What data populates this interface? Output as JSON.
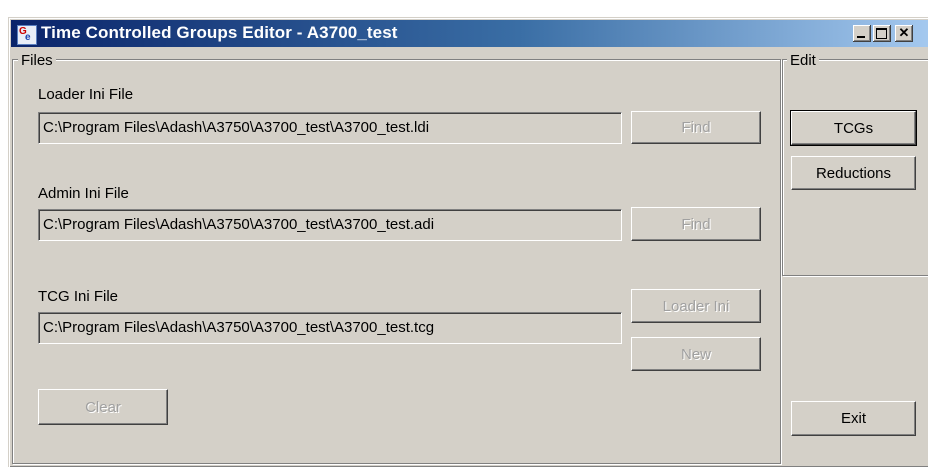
{
  "window": {
    "title": "Time Controlled Groups Editor - A3700_test",
    "icon": "tcg-app-icon",
    "icon_glyphs": [
      "G",
      "e"
    ],
    "controls": {
      "minimize": "minimize-icon",
      "maximize": "maximize-icon",
      "close": "✕"
    },
    "title_gradient": [
      "#0a246a",
      "#a6caf0"
    ],
    "face_color": "#d4d0c8"
  },
  "files": {
    "group_label": "Files",
    "loader": {
      "label": "Loader Ini File",
      "value": "C:\\Program Files\\Adash\\A3750\\A3700_test\\A3700_test.ldi",
      "find_label": "Find"
    },
    "admin": {
      "label": "Admin Ini File",
      "value": "C:\\Program Files\\Adash\\A3750\\A3700_test\\A3700_test.adi",
      "find_label": "Find"
    },
    "tcg": {
      "label": "TCG Ini File",
      "value": "C:\\Program Files\\Adash\\A3750\\A3700_test\\A3700_test.tcg",
      "loader_ini_label": "Loader Ini",
      "new_label": "New"
    },
    "clear_label": "Clear"
  },
  "edit": {
    "group_label": "Edit",
    "tcgs_label": "TCGs",
    "reductions_label": "Reductions"
  },
  "exit_label": "Exit"
}
